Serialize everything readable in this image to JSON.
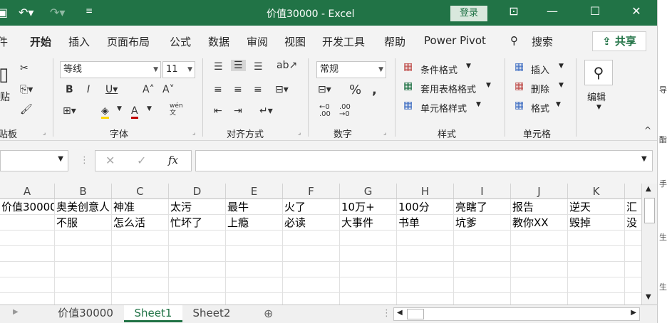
{
  "titlebar": {
    "title": "价值30000  -  Excel",
    "signin": "登录",
    "colors": {
      "accent": "#217346"
    }
  },
  "ribbon_tabs": [
    "件",
    "开始",
    "插入",
    "页面布局",
    "公式",
    "数据",
    "审阅",
    "视图",
    "开发工具",
    "帮助",
    "Power Pivot",
    "搜索"
  ],
  "share_label": "共享",
  "ribbon": {
    "clipboard": {
      "paste": "贴",
      "label": "贴板"
    },
    "font": {
      "name": "等线",
      "size": "11",
      "label": "字体",
      "phonetic": "wén\n文"
    },
    "alignment": {
      "label": "对齐方式"
    },
    "number": {
      "format": "常规",
      "label": "数字"
    },
    "styles": {
      "conditional": "条件格式",
      "table": "套用表格格式",
      "cell": "单元格样式",
      "label": "样式"
    },
    "cells": {
      "insert": "插入",
      "delete": "删除",
      "format": "格式",
      "label": "单元格"
    },
    "editing": {
      "label": "编辑"
    }
  },
  "formula_bar": {
    "fx": "fx",
    "value": ""
  },
  "columns": [
    "A",
    "B",
    "C",
    "D",
    "E",
    "F",
    "G",
    "H",
    "I",
    "J",
    "K"
  ],
  "rows": [
    [
      "价值30000",
      "奥美创意人",
      "神准",
      "太污",
      "最牛",
      "火了",
      "10万+",
      "100分",
      "亮瞎了",
      "报告",
      "逆天",
      "汇"
    ],
    [
      "",
      "不服",
      "怎么活",
      "忙坏了",
      "上瘾",
      "必读",
      "大事件",
      "书单",
      "坑爹",
      "教你XX",
      "毁掉",
      "没"
    ]
  ],
  "sheets": [
    "价值30000",
    "Sheet1",
    "Sheet2"
  ],
  "active_sheet": "Sheet1",
  "right_strip_chars": [
    "导",
    "导",
    "酯",
    "手",
    "手",
    "生",
    "生"
  ]
}
